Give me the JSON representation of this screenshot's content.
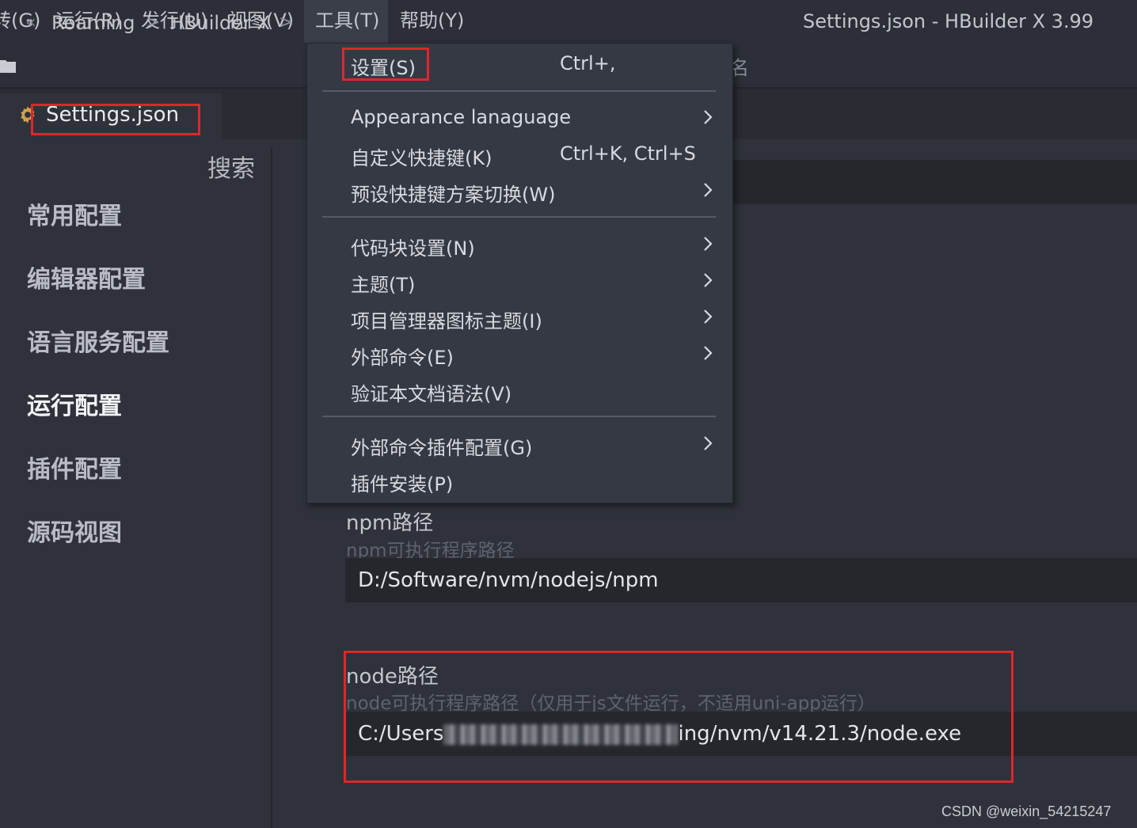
{
  "menubar": {
    "items": [
      "ऀ(G)",
      "运行(R)",
      "发行(U)",
      "视图(V)",
      "工具(T)",
      "帮助(Y)"
    ],
    "first_label": "转(G)",
    "run": "运行(R)",
    "publish": "发行(U)",
    "view": "视图(V)",
    "tools": "工具(T)",
    "help": "帮助(Y)"
  },
  "window": {
    "title": "Settings.json - HBuilder X 3.99"
  },
  "breadcrumb": {
    "back": "«",
    "items": [
      "Roaming",
      "HBuilder X"
    ],
    "sep": ">",
    "hidden_fragment": "名"
  },
  "tab": {
    "label": "Settings.json"
  },
  "sidebar": {
    "search_label": "搜索",
    "items": [
      "常用配置",
      "编辑器配置",
      "语言服务配置",
      "运行配置",
      "插件配置",
      "源码视图"
    ],
    "active_index": 3
  },
  "tools_menu": {
    "settings": {
      "label": "设置(S)",
      "shortcut": "Ctrl+,"
    },
    "appearance": {
      "label": "Appearance lanaguage"
    },
    "custom_keys": {
      "label": "自定义快捷键(K)",
      "shortcut": "Ctrl+K, Ctrl+S"
    },
    "preset_keys": {
      "label": "预设快捷键方案切换(W)"
    },
    "snippets": {
      "label": "代码块设置(N)"
    },
    "theme": {
      "label": "主题(T)"
    },
    "icon_theme": {
      "label": "项目管理器图标主题(I)"
    },
    "external_cmd": {
      "label": "外部命令(E)"
    },
    "validate": {
      "label": "验证本文档语法(V)"
    },
    "ext_cmd_plugin": {
      "label": "外部命令插件配置(G)"
    },
    "plugin_install": {
      "label": "插件安装(P)"
    }
  },
  "settings": {
    "npm": {
      "title": "npm路径",
      "desc": "npm可执行程序路径",
      "value": "D:/Software/nvm/nodejs/npm"
    },
    "node": {
      "title": "node路径",
      "desc": "node可执行程序路径（仅用于js文件运行，不适用uni-app运行）",
      "value_prefix": "C:/Users",
      "value_suffix": "ing/nvm/v14.21.3/node.exe"
    }
  },
  "watermark": "CSDN @weixin_54215247",
  "colors": {
    "background": "#2f323b",
    "menu": "#353944",
    "highlight_box": "#e0262b"
  }
}
